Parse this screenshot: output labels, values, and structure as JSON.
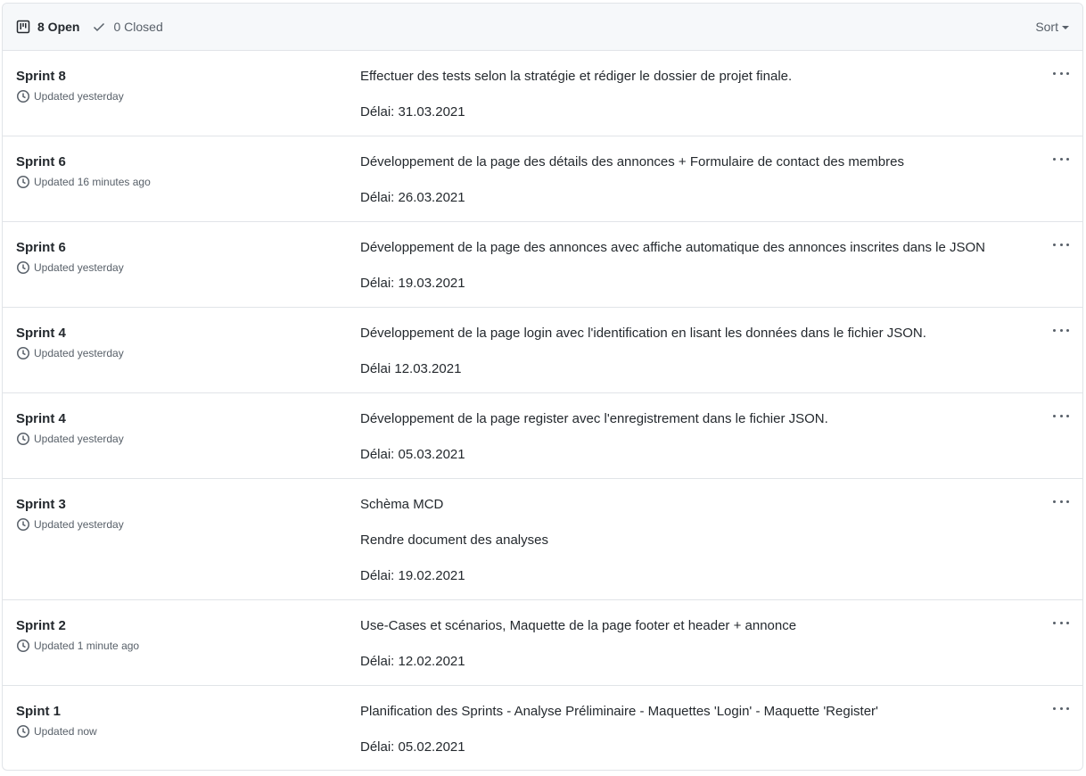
{
  "header": {
    "open_label": "8 Open",
    "closed_label": "0 Closed",
    "sort_label": "Sort"
  },
  "milestones": [
    {
      "title": "Sprint 8",
      "updated": "Updated yesterday",
      "lines": [
        "Effectuer des tests selon la stratégie et rédiger le dossier de projet finale.",
        "Délai: 31.03.2021"
      ]
    },
    {
      "title": "Sprint 6",
      "updated": "Updated 16 minutes ago",
      "lines": [
        "Développement de la page des détails des annonces + Formulaire de contact des membres",
        "Délai: 26.03.2021"
      ]
    },
    {
      "title": "Sprint 6",
      "updated": "Updated yesterday",
      "lines": [
        "Développement de la page des annonces avec affiche automatique des annonces inscrites dans le JSON",
        "Délai: 19.03.2021"
      ]
    },
    {
      "title": "Sprint 4",
      "updated": "Updated yesterday",
      "lines": [
        "Développement de la page login avec l'identification en lisant les données dans le fichier JSON.",
        "Délai 12.03.2021"
      ]
    },
    {
      "title": "Sprint 4",
      "updated": "Updated yesterday",
      "lines": [
        "Développement de la page register avec l'enregistrement dans le fichier JSON.",
        "Délai: 05.03.2021"
      ]
    },
    {
      "title": "Sprint 3",
      "updated": "Updated yesterday",
      "lines": [
        "Schèma MCD",
        "Rendre document des analyses",
        "Délai: 19.02.2021"
      ]
    },
    {
      "title": "Sprint 2",
      "updated": "Updated 1 minute ago",
      "lines": [
        "Use-Cases et scénarios, Maquette de la page footer et header + annonce",
        "Délai: 12.02.2021"
      ]
    },
    {
      "title": "Spint 1",
      "updated": "Updated now",
      "lines": [
        "Planification des Sprints - Analyse Préliminaire - Maquettes 'Login' - Maquette 'Register'",
        "Délai: 05.02.2021"
      ]
    }
  ]
}
